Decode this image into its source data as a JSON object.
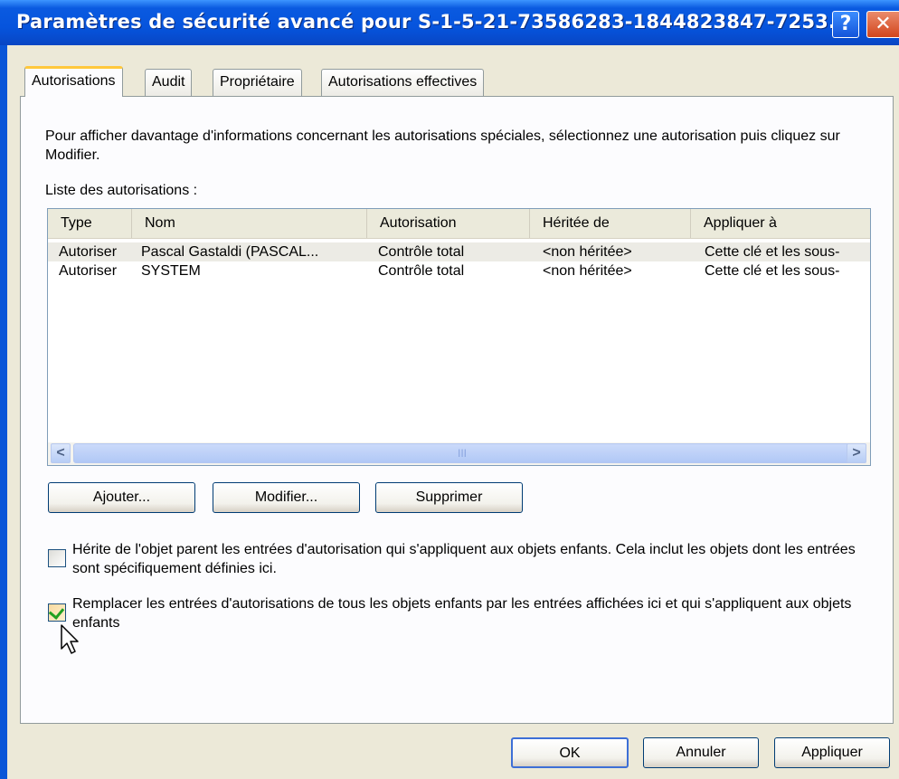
{
  "window": {
    "title": "Paramètres de sécurité avancé pour S-1-5-21-73586283-1844823847-7253...",
    "help_label": "?",
    "close_label": "✕"
  },
  "tabs": [
    {
      "label": "Autorisations",
      "active": true
    },
    {
      "label": "Audit"
    },
    {
      "label": "Propriétaire"
    },
    {
      "label": "Autorisations effectives"
    }
  ],
  "description": "Pour afficher davantage d'informations concernant les autorisations spéciales, sélectionnez une autorisation puis cliquez sur Modifier.",
  "list_label": "Liste des autorisations :",
  "list": {
    "columns": [
      "Type",
      "Nom",
      "Autorisation",
      "Héritée de",
      "Appliquer à"
    ],
    "rows": [
      {
        "type": "Autoriser",
        "name": "Pascal Gastaldi (PASCAL...",
        "permission": "Contrôle total",
        "inherited": "<non héritée>",
        "apply": "Cette clé et les sous-"
      },
      {
        "type": "Autoriser",
        "name": "SYSTEM",
        "permission": "Contrôle total",
        "inherited": "<non héritée>",
        "apply": "Cette clé et les sous-"
      }
    ],
    "scroll_left": "<",
    "scroll_right": ">",
    "thumb_grip": "III"
  },
  "buttons": {
    "add": "Ajouter...",
    "edit": "Modifier...",
    "remove": "Supprimer",
    "ok": "OK",
    "cancel": "Annuler",
    "apply": "Appliquer"
  },
  "checkboxes": {
    "inherit": {
      "label": "Hérite de l'objet parent les entrées d'autorisation qui s'appliquent aux objets enfants. Cela inclut les objets dont les entrées sont spécifiquement définies ici.",
      "checked": false
    },
    "replace": {
      "label": "Remplacer les entrées d'autorisations de tous les objets enfants par les entrées affichées ici et qui s'appliquent aux objets enfants",
      "checked": true
    }
  },
  "colors": {
    "titlebar": "#0654dd",
    "dialog_bg": "#ece9d8",
    "active_tab_accent": "#ffc83c",
    "check_mark": "#21a121"
  }
}
